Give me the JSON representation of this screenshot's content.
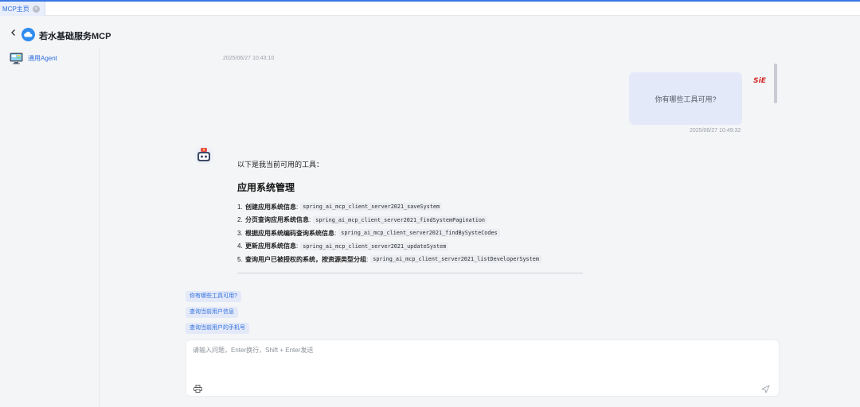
{
  "tabs": [
    {
      "label": "MCP主页",
      "close": "×"
    }
  ],
  "header": {
    "back_icon": "chevron-left-icon",
    "logo_icon": "cloud-logo-icon",
    "title": "若水基础服务MCP"
  },
  "sidebar": {
    "items": [
      {
        "label": "通用Agent",
        "icon": "monitor-agent-icon"
      }
    ]
  },
  "chat": {
    "bot_timestamp": "2025/06/27 10:43:10",
    "user_message": {
      "text": "你有哪些工具可用?",
      "timestamp": "2025/06/27 10:49:32",
      "avatar_text": "SiE"
    },
    "bot_message": {
      "intro": "以下是我当前可用的工具：",
      "heading": "应用系统管理",
      "tools": [
        {
          "num": "1.",
          "name": "创建应用系统信息",
          "code": "spring_ai_mcp_client_server2021_saveSystem"
        },
        {
          "num": "2.",
          "name": "分页查询应用系统信息",
          "code": "spring_ai_mcp_client_server2021_findSystemPagination"
        },
        {
          "num": "3.",
          "name": "根据应用系统编码查询系统信息",
          "code": "spring_ai_mcp_client_server2021_findBySysteCodes"
        },
        {
          "num": "4.",
          "name": "更新应用系统信息",
          "code": "spring_ai_mcp_client_server2021_updateSystem"
        },
        {
          "num": "5.",
          "name": "查询用户已被授权的系统，按资源类型分组",
          "code": "spring_ai_mcp_client_server2021_listDeveloperSystem"
        }
      ]
    }
  },
  "suggestions": [
    "你有哪些工具可用?",
    "查询当前用户信息",
    "查询当前用户的手机号"
  ],
  "input": {
    "placeholder": "请输入问题，Enter换行，Shift + Enter发送",
    "value": ""
  },
  "colors": {
    "accent": "#2f6fde",
    "tab_border": "#3a78e7",
    "user_bubble": "#e3e9f8",
    "avatar_red": "#d22a2a"
  }
}
